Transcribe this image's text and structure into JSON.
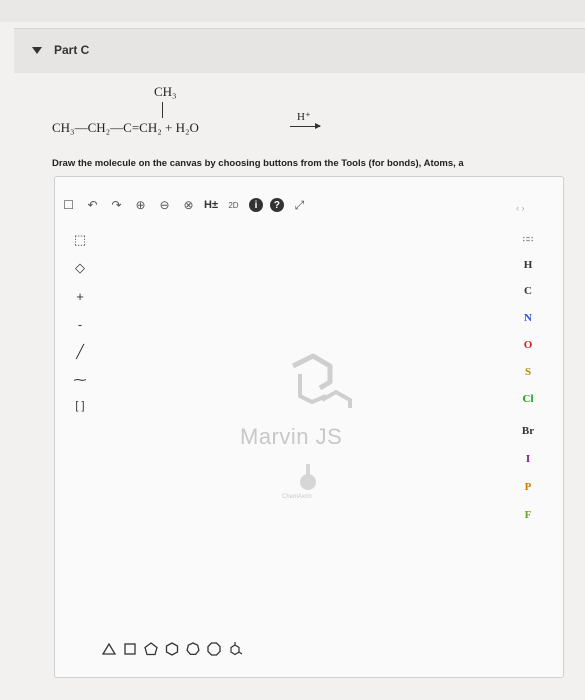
{
  "part": {
    "label": "Part C"
  },
  "reaction": {
    "substituent": "CH₃",
    "equation": "CH₃—CH₂—C=CH₂ + H₂O",
    "catalyst": "H⁺"
  },
  "instruction": "Draw the molecule on the canvas by choosing buttons from the Tools (for bonds), Atoms, a",
  "editor": {
    "toolbar": {
      "new": "☐",
      "undo": "↶",
      "redo": "↷",
      "zoom_in": "⊕",
      "zoom_out": "⊖",
      "zoom_fit": "⊗",
      "hydrogens": "H±",
      "clean2d": "2D",
      "info": "i",
      "help": "?",
      "fullscreen": "⤢"
    },
    "right_top_marker": "‹ ›",
    "left_tools": [
      {
        "name": "select-tool",
        "glyph": "⬚"
      },
      {
        "name": "eraser-tool",
        "glyph": "◇"
      },
      {
        "name": "increase-charge",
        "glyph": "+"
      },
      {
        "name": "decrease-charge",
        "glyph": "-"
      },
      {
        "name": "single-bond",
        "glyph": "╱"
      },
      {
        "name": "chain-tool",
        "glyph": "⁓"
      },
      {
        "name": "bracket-tool",
        "glyph": "[ ]"
      }
    ],
    "periodic_table_label": "∷∷",
    "atoms": [
      "H",
      "C",
      "N",
      "O",
      "S",
      "Cl",
      "Br",
      "I",
      "P",
      "F"
    ],
    "atom_colors": {
      "H": "#333333",
      "C": "#333333",
      "N": "#2b4fd6",
      "O": "#d42020",
      "S": "#b38600",
      "Cl": "#1a9b1a",
      "Br": "#8b2a1a",
      "I": "#7a1a8a",
      "P": "#d07a00",
      "F": "#6aa020"
    },
    "logo_text": "Marvin JS",
    "logo_sub": "ChemAxon",
    "shape_tools": [
      "triangle",
      "square",
      "pentagon",
      "hexagon",
      "heptagon",
      "octagon",
      "benzene"
    ]
  }
}
